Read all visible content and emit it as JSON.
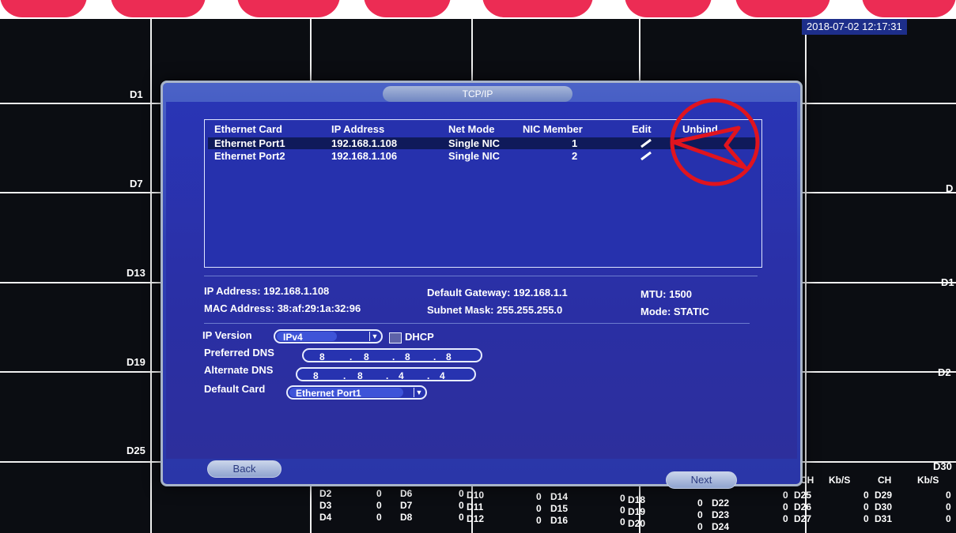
{
  "datetime": "2018-07-02 12:17:31",
  "channels": {
    "left": [
      "D1",
      "D7",
      "D13",
      "D19",
      "D25"
    ],
    "right": [
      "D",
      "D1",
      "D2",
      "D30"
    ]
  },
  "dialog": {
    "title": "TCP/IP",
    "table": {
      "headers": [
        "Ethernet Card",
        "IP Address",
        "Net Mode",
        "NIC Member",
        "Edit",
        "Unbind"
      ],
      "rows": [
        {
          "card": "Ethernet Port1",
          "ip": "192.168.1.108",
          "mode": "Single NIC",
          "member": "1"
        },
        {
          "card": "Ethernet Port2",
          "ip": "192.168.1.106",
          "mode": "Single NIC",
          "member": "2"
        }
      ]
    },
    "info": {
      "ip_address": "IP Address: 192.168.1.108",
      "mac_address": "MAC Address: 38:af:29:1a:32:96",
      "gateway": "Default Gateway: 192.168.1.1",
      "subnet": "Subnet Mask: 255.255.255.0",
      "mtu": "MTU: 1500",
      "mode": "Mode: STATIC"
    },
    "form": {
      "ip_version_label": "IP Version",
      "ip_version_value": "IPv4",
      "dhcp_label": "DHCP",
      "preferred_dns_label": "Preferred DNS",
      "preferred_dns": [
        "8",
        "8",
        "8",
        "8"
      ],
      "alternate_dns_label": "Alternate DNS",
      "alternate_dns": [
        "8",
        "8",
        "4",
        "4"
      ],
      "default_card_label": "Default Card",
      "default_card_value": "Ethernet Port1",
      "dot": "."
    },
    "buttons": {
      "back": "Back",
      "next": "Next"
    }
  },
  "stats": {
    "col_headers": [
      "CH",
      "Kb/S",
      "CH",
      "Kb/S"
    ],
    "cols": [
      {
        "ch": [
          "D2",
          "D3",
          "D4"
        ],
        "kb": [
          "0",
          "0",
          "0"
        ]
      },
      {
        "ch": [
          "D6",
          "D7",
          "D8"
        ],
        "kb": [
          "0",
          "0",
          "0"
        ]
      },
      {
        "ch": [
          "D10",
          "D11",
          "D12"
        ],
        "kb": [
          "0",
          "0",
          "0"
        ]
      },
      {
        "ch": [
          "D14",
          "D15",
          "D16"
        ],
        "kb": [
          "0",
          "0",
          "0"
        ]
      },
      {
        "ch": [
          "D18",
          "D19",
          "D20"
        ],
        "kb": [
          "0",
          "0",
          "0"
        ]
      },
      {
        "ch": [
          "D22",
          "D23",
          "D24"
        ],
        "kb": [
          "0",
          "0",
          "0"
        ]
      },
      {
        "ch": [
          "D25",
          "D26",
          "D27"
        ],
        "kb": [
          "0",
          "0",
          "0"
        ]
      },
      {
        "ch": [
          "D29",
          "D30",
          "D31"
        ],
        "kb": [
          "0",
          "0",
          "0"
        ]
      }
    ]
  },
  "colors": {
    "dialog_blue": "#2a36a8",
    "annotation_red": "#e0141e",
    "watermark_pink": "#ec2c54"
  }
}
